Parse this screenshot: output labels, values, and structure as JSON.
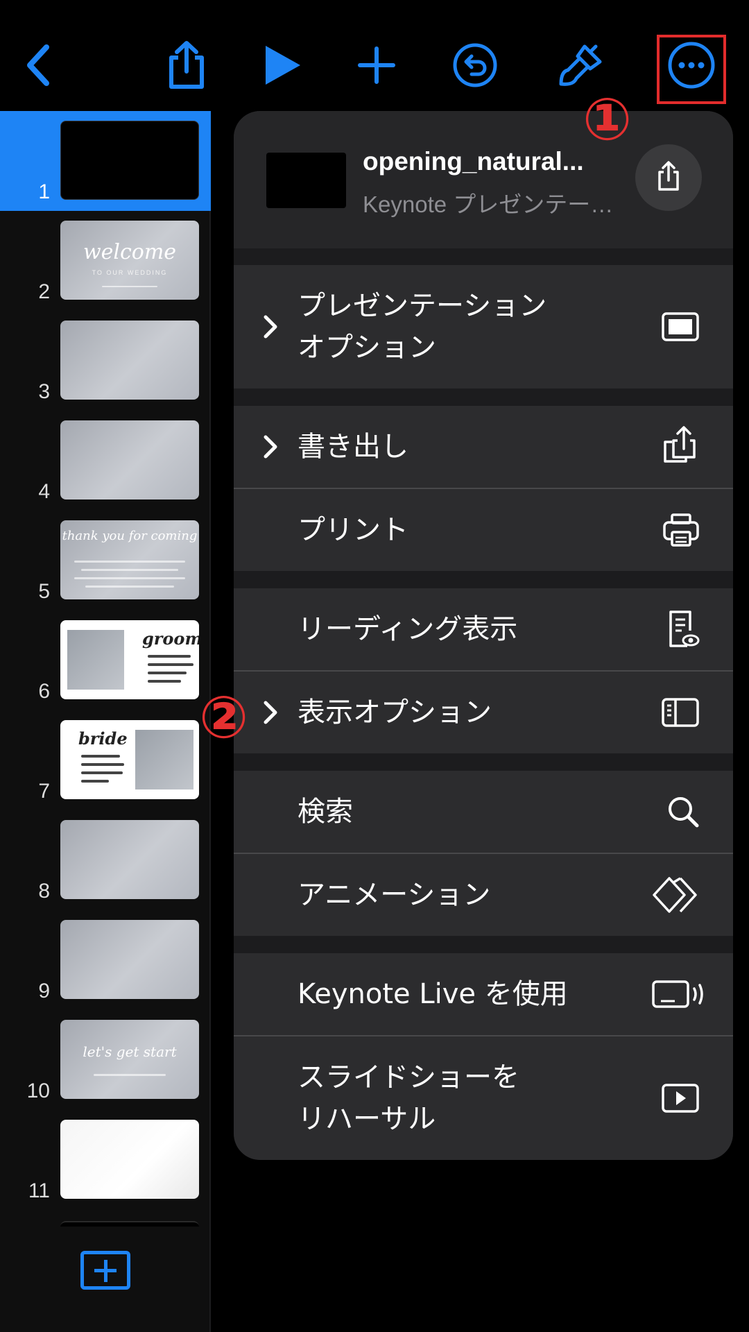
{
  "toolbar": {
    "back": "back-chevron-icon",
    "share": "share-icon",
    "play": "play-icon",
    "add": "plus-icon",
    "undo": "undo-icon",
    "format": "paintbrush-icon",
    "more": "more-ellipsis-icon",
    "accent_color": "#1e84f5"
  },
  "annotations": {
    "callout1": "①",
    "callout2": "②",
    "highlight_color": "#e22c2c"
  },
  "navigator": {
    "slides": [
      {
        "number": "1",
        "kind": "black"
      },
      {
        "number": "2",
        "kind": "title",
        "script_text": "welcome",
        "caption": "TO OUR WEDDING"
      },
      {
        "number": "3",
        "kind": "plain"
      },
      {
        "number": "4",
        "kind": "plain"
      },
      {
        "number": "5",
        "kind": "message",
        "script_text": "thank you for coming"
      },
      {
        "number": "6",
        "kind": "profile-groom",
        "script_text": "groom",
        "lines": [
          "Name 新郎新郎",
          "Birthday 1991/6/23",
          "From 大阪府豊中",
          "Hobby サッカー"
        ]
      },
      {
        "number": "7",
        "kind": "profile-bride",
        "script_text": "bride",
        "lines": [
          "Name 新婦新婦",
          "Birthday 1993/6/8",
          "From 大阪府茨木市",
          "Hobby 旅行"
        ]
      },
      {
        "number": "8",
        "kind": "plain"
      },
      {
        "number": "9",
        "kind": "plain"
      },
      {
        "number": "10",
        "kind": "start",
        "script_text": "let's get start"
      },
      {
        "number": "11",
        "kind": "white"
      }
    ],
    "selected": "1",
    "add_slide": "add-slide-icon"
  },
  "menu": {
    "document": {
      "title": "opening_natural...",
      "subtitle": "Keynote プレゼンテー…"
    },
    "items": [
      {
        "label_lines": [
          "プレゼンテーション",
          "オプション"
        ],
        "chevron": true,
        "icon": "presentation-screen-icon"
      },
      {
        "label_lines": [
          "書き出し"
        ],
        "chevron": true,
        "icon": "export-icon"
      },
      {
        "label_lines": [
          "プリント"
        ],
        "chevron": false,
        "icon": "printer-icon"
      },
      {
        "label_lines": [
          "リーディング表示"
        ],
        "chevron": false,
        "icon": "reading-view-icon"
      },
      {
        "label_lines": [
          "表示オプション"
        ],
        "chevron": true,
        "icon": "sidebar-view-icon"
      },
      {
        "label_lines": [
          "検索"
        ],
        "chevron": false,
        "icon": "search-icon"
      },
      {
        "label_lines": [
          "アニメーション"
        ],
        "chevron": false,
        "icon": "animation-icon"
      },
      {
        "label_lines": [
          "Keynote Live を使用"
        ],
        "chevron": false,
        "icon": "keynote-live-icon"
      },
      {
        "label_lines": [
          "スライドショーを",
          "リハーサル"
        ],
        "chevron": false,
        "icon": "rehearse-play-icon"
      }
    ]
  }
}
